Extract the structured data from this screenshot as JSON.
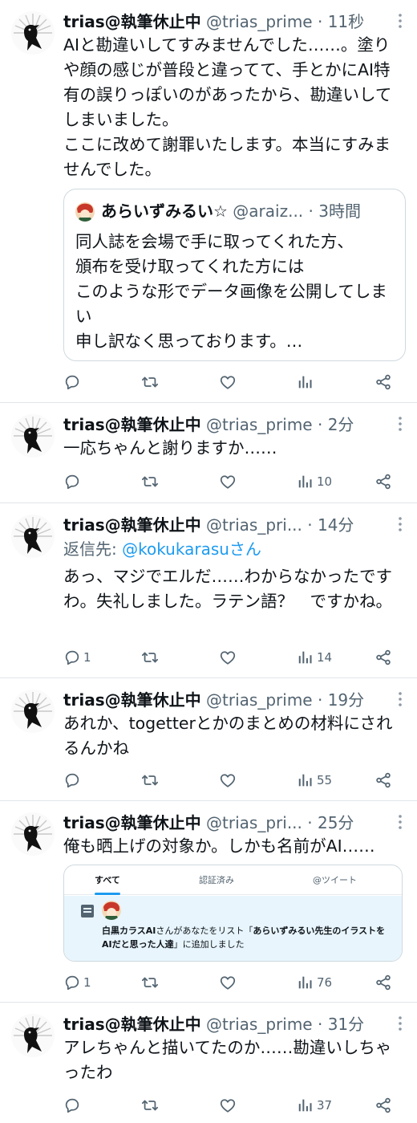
{
  "author": {
    "name": "trias@執筆休止中",
    "handle_full": "@trias_prime",
    "handle_truncated": "@trias_pri...",
    "dot": "·"
  },
  "tweets": [
    {
      "time": "11秒",
      "body": "AIと勘違いしてすみませんでした……。塗りや顔の感じが普段と違ってて、手とかにAI特有の誤りっぽいのがあったから、勘違いしてしまいました。\nここに改めて謝罪いたします。本当にすみませんでした。",
      "quote": {
        "name": "あらいずみるい☆",
        "handle": "@araiz...",
        "time": "3時間",
        "body": "同人誌を会場で手に取ってくれた方、\n頒布を受け取ってくれた方には\nこのような形でデータ画像を公開してしまい\n申し訳なく思っております。…"
      },
      "replies": "",
      "views": ""
    },
    {
      "time": "2分",
      "body": "一応ちゃんと謝りますか……",
      "replies": "",
      "views": "10"
    },
    {
      "time": "14分",
      "reply_prefix": "返信先: ",
      "reply_mention": "@kokukarasu",
      "reply_suffix": "さん",
      "body": "あっ、マジでエルだ……わからなかったですわ。失礼しました。ラテン語？　ですかね。",
      "replies": "1",
      "views": "14"
    },
    {
      "time": "19分",
      "body": "あれか、togetterとかのまとめの材料にされるんかね",
      "replies": "",
      "views": "55"
    },
    {
      "time": "25分",
      "body": "俺も晒上げの対象か。しかも名前がAI……",
      "image": {
        "tabs": [
          "すべて",
          "認証済み",
          "@ツイート"
        ],
        "notif_prefix": "白黒カラスAI",
        "notif_middle": "さんがあなたをリスト「",
        "notif_list": "あらいずみるい先生のイラストをAIだと思った人達",
        "notif_suffix": "」に追加しました"
      },
      "replies": "1",
      "views": "76"
    },
    {
      "time": "31分",
      "body": "アレちゃんと描いてたのか……勘違いしちゃったわ",
      "replies": "",
      "views": "37"
    }
  ],
  "icons": [
    "reply-icon",
    "retweet-icon",
    "like-icon",
    "views-icon",
    "share-icon",
    "more-icon"
  ],
  "colors": {
    "text": "#0f1419",
    "secondary": "#536471",
    "link": "#1d9bf0",
    "border": "#e1e6ea"
  }
}
